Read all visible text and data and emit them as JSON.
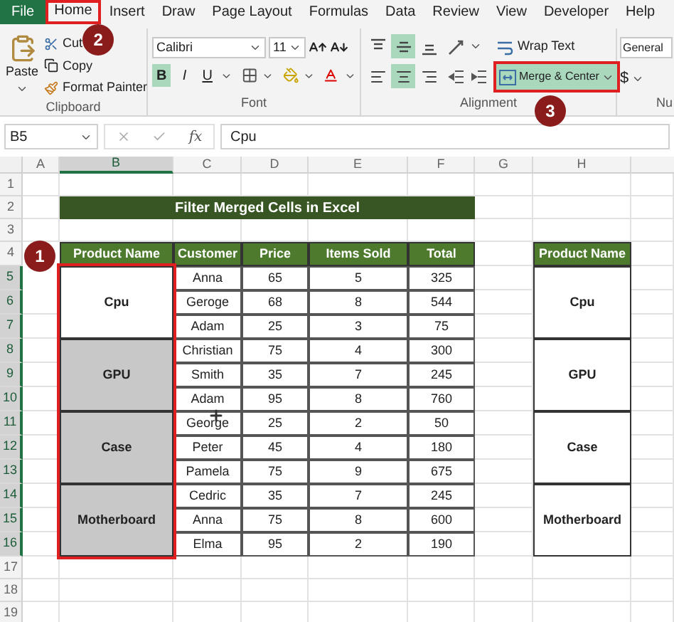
{
  "ribbon_tabs": [
    {
      "label": "File",
      "kind": "file",
      "selected": false,
      "highlighted": false
    },
    {
      "label": "Home",
      "kind": "tab",
      "selected": true,
      "highlighted": true,
      "callout": "2"
    },
    {
      "label": "Insert",
      "kind": "tab",
      "selected": false,
      "highlighted": false
    },
    {
      "label": "Draw",
      "kind": "tab",
      "selected": false,
      "highlighted": false
    },
    {
      "label": "Page Layout",
      "kind": "tab",
      "selected": false,
      "highlighted": false
    },
    {
      "label": "Formulas",
      "kind": "tab",
      "selected": false,
      "highlighted": false
    },
    {
      "label": "Data",
      "kind": "tab",
      "selected": false,
      "highlighted": false
    },
    {
      "label": "Review",
      "kind": "tab",
      "selected": false,
      "highlighted": false
    },
    {
      "label": "View",
      "kind": "tab",
      "selected": false,
      "highlighted": false
    },
    {
      "label": "Developer",
      "kind": "tab",
      "selected": false,
      "highlighted": false
    },
    {
      "label": "Help",
      "kind": "tab",
      "selected": false,
      "highlighted": false
    }
  ],
  "clipboard": {
    "paste": "Paste",
    "cut": "Cut",
    "copy": "Copy",
    "format_painter": "Format Painter",
    "label": "Clipboard"
  },
  "font": {
    "name": "Calibri",
    "size": "11",
    "bold": {
      "label": "B",
      "selected": true
    },
    "italic": {
      "label": "I",
      "selected": false
    },
    "underline": {
      "label": "U",
      "selected": false
    },
    "label": "Font"
  },
  "alignment": {
    "vertical_align": [
      {
        "selected": false
      },
      {
        "selected": true
      },
      {
        "selected": false
      }
    ],
    "horizontal_align": [
      {
        "selected": false
      },
      {
        "selected": true
      },
      {
        "selected": false
      }
    ],
    "wrap_text": "Wrap Text",
    "merge": {
      "label": "Merge & Center",
      "selected": true,
      "highlighted": true,
      "callout": "3"
    },
    "label": "Alignment"
  },
  "number": {
    "format": "General",
    "currency": "$",
    "label": "Nu"
  },
  "formula_bar": {
    "name_box": "B5",
    "function_symbol": "fx",
    "formula": "Cpu"
  },
  "sheet": {
    "columns": [
      {
        "label": "A",
        "selected": false
      },
      {
        "label": "B",
        "selected": true
      },
      {
        "label": "C",
        "selected": false
      },
      {
        "label": "D",
        "selected": false
      },
      {
        "label": "E",
        "selected": false
      },
      {
        "label": "F",
        "selected": false
      },
      {
        "label": "G",
        "selected": false
      },
      {
        "label": "H",
        "selected": false
      }
    ],
    "rows": [
      {
        "label": "1",
        "selected": false
      },
      {
        "label": "2",
        "selected": false
      },
      {
        "label": "3",
        "selected": false
      },
      {
        "label": "4",
        "selected": false
      },
      {
        "label": "5",
        "selected": true
      },
      {
        "label": "6",
        "selected": true
      },
      {
        "label": "7",
        "selected": true
      },
      {
        "label": "8",
        "selected": true
      },
      {
        "label": "9",
        "selected": true
      },
      {
        "label": "10",
        "selected": true
      },
      {
        "label": "11",
        "selected": true
      },
      {
        "label": "12",
        "selected": true
      },
      {
        "label": "13",
        "selected": true
      },
      {
        "label": "14",
        "selected": true
      },
      {
        "label": "15",
        "selected": true
      },
      {
        "label": "16",
        "selected": true
      },
      {
        "label": "17",
        "selected": false
      },
      {
        "label": "18",
        "selected": false
      },
      {
        "label": "19",
        "selected": false
      }
    ],
    "title": "Filter Merged Cells in Excel",
    "table": {
      "columns": [
        "Product Name",
        "Customer",
        "Price",
        "Items Sold",
        "Total"
      ],
      "highlighted": true,
      "callout": "1",
      "groups": [
        {
          "product": "Cpu",
          "active": true,
          "rows": [
            [
              "Anna",
              "65",
              "5",
              "325"
            ],
            [
              "Geroge",
              "68",
              "8",
              "544"
            ],
            [
              "Adam",
              "25",
              "3",
              "75"
            ]
          ]
        },
        {
          "product": "GPU",
          "active": false,
          "rows": [
            [
              "Christian",
              "75",
              "4",
              "300"
            ],
            [
              "Smith",
              "35",
              "7",
              "245"
            ],
            [
              "Adam",
              "95",
              "8",
              "760"
            ]
          ]
        },
        {
          "product": "Case",
          "active": false,
          "rows": [
            [
              "George",
              "25",
              "2",
              "50"
            ],
            [
              "Peter",
              "45",
              "4",
              "180"
            ],
            [
              "Pamela",
              "75",
              "9",
              "675"
            ]
          ]
        },
        {
          "product": "Motherboard",
          "active": false,
          "rows": [
            [
              "Cedric",
              "35",
              "7",
              "245"
            ],
            [
              "Anna",
              "75",
              "8",
              "600"
            ],
            [
              "Elma",
              "95",
              "2",
              "190"
            ]
          ]
        }
      ]
    },
    "summary": {
      "header": "Product Name",
      "items": [
        "Cpu",
        "GPU",
        "Case",
        "Motherboard"
      ]
    }
  }
}
